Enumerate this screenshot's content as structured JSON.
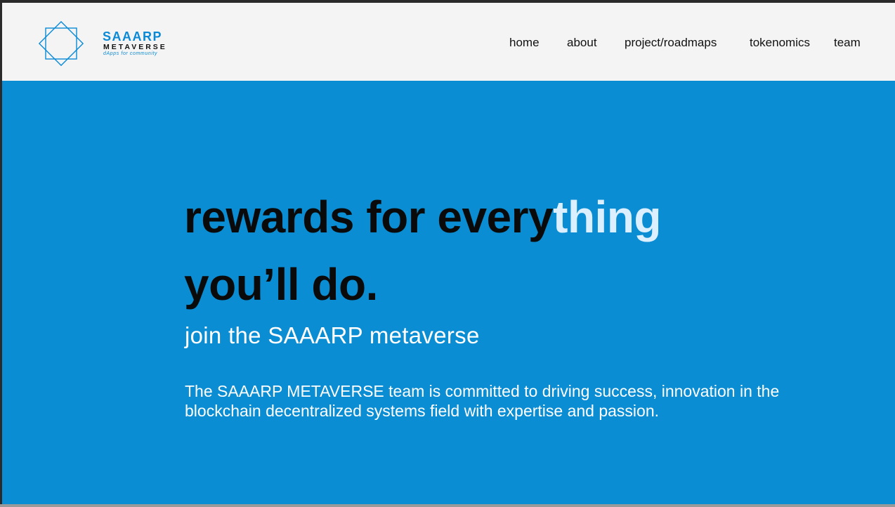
{
  "brand": {
    "title": "SAAARP",
    "subtitle": "METAVERSE",
    "tagline": "dApps for community",
    "accent_color": "#0a8ad6"
  },
  "nav": {
    "items": [
      {
        "label": "home"
      },
      {
        "label": "about"
      },
      {
        "label": "project/roadmaps"
      },
      {
        "label": "tokenomics"
      },
      {
        "label": "team"
      }
    ]
  },
  "hero": {
    "background_color": "#0a8dd2",
    "headline_part1": "rewards for every",
    "headline_highlight": "thing",
    "headline_line2": "you’ll do.",
    "subheading": "join the SAAARP metaverse",
    "description": "The SAAARP METAVERSE team is committed to driving success, innovation in the blockchain decentralized systems field with expertise and passion."
  }
}
